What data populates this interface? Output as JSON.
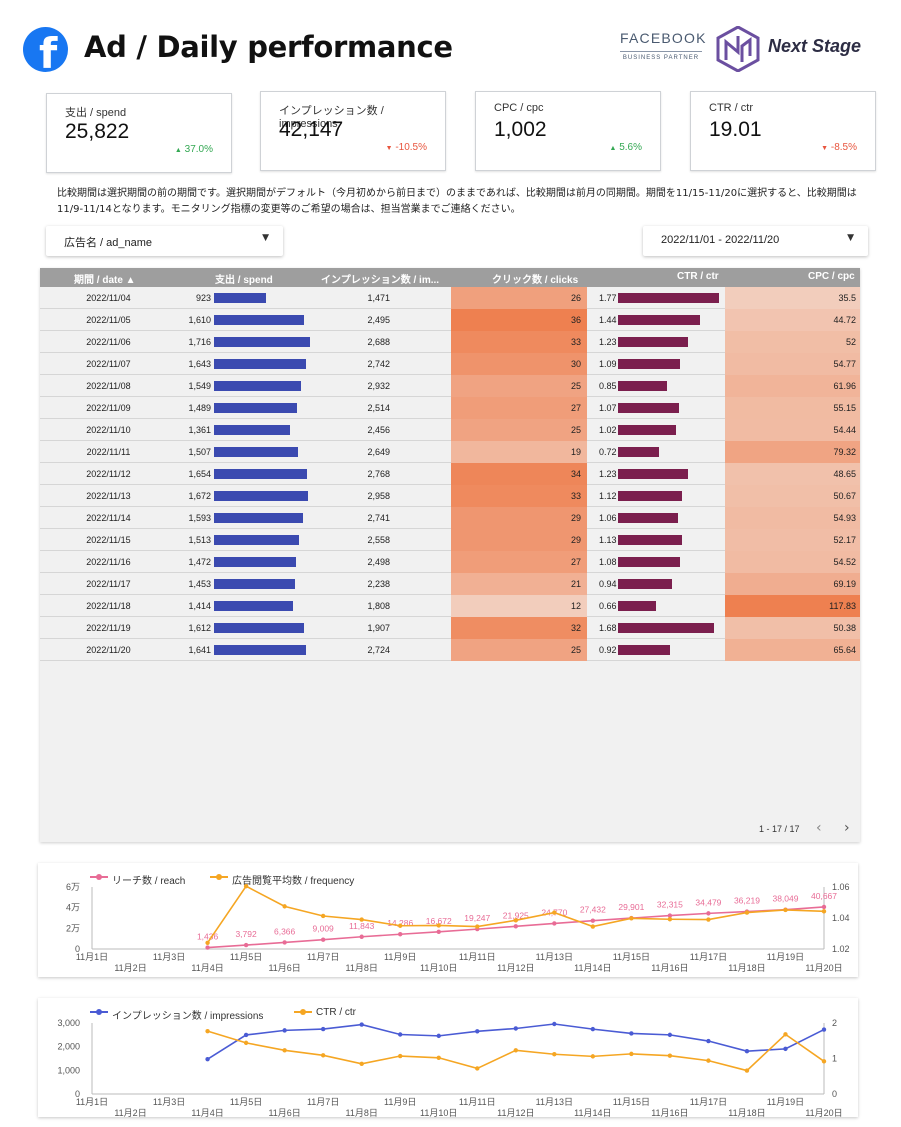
{
  "header": {
    "title": "Ad / Daily performance",
    "fb_logo_letter": "f",
    "facebook": "FACEBOOK",
    "business_partner": "BUSINESS PARTNER",
    "brand": "Next Stage"
  },
  "kpis": [
    {
      "label": "支出 / spend",
      "value": "25,822",
      "change": "37.0%",
      "direction": "up"
    },
    {
      "label": "インプレッション数 / impressions",
      "value": "42,147",
      "change": "-10.5%",
      "direction": "down"
    },
    {
      "label": "CPC / cpc",
      "value": "1,002",
      "change": "5.6%",
      "direction": "up"
    },
    {
      "label": "CTR / ctr",
      "value": "19.01",
      "change": "-8.5%",
      "direction": "down"
    }
  ],
  "note": "比較期間は選択期間の前の期間です。選択期間がデフォルト（今月初めから前日まで）のままであれば、比較期間は前月の同期間。期間を11/15-11/20に選択すると、比較期間は11/9-11/14となります。モニタリング指標の変更等のご希望の場合は、担当営業までご連絡ください。",
  "filters": {
    "ad_name": "広告名 / ad_name",
    "date_range": "2022/11/01 - 2022/11/20"
  },
  "table": {
    "headers": [
      "期間 / date ▲",
      "支出 / spend",
      "インプレッション数 / im...",
      "クリック数 / clicks",
      "CTR / ctr",
      "CPC / cpc"
    ],
    "rows": [
      {
        "date": "2022/11/04",
        "spend": "923",
        "impressions": "1,471",
        "clicks": "26",
        "ctr": "1.77",
        "cpc": "35.5"
      },
      {
        "date": "2022/11/05",
        "spend": "1,610",
        "impressions": "2,495",
        "clicks": "36",
        "ctr": "1.44",
        "cpc": "44.72"
      },
      {
        "date": "2022/11/06",
        "spend": "1,716",
        "impressions": "2,688",
        "clicks": "33",
        "ctr": "1.23",
        "cpc": "52"
      },
      {
        "date": "2022/11/07",
        "spend": "1,643",
        "impressions": "2,742",
        "clicks": "30",
        "ctr": "1.09",
        "cpc": "54.77"
      },
      {
        "date": "2022/11/08",
        "spend": "1,549",
        "impressions": "2,932",
        "clicks": "25",
        "ctr": "0.85",
        "cpc": "61.96"
      },
      {
        "date": "2022/11/09",
        "spend": "1,489",
        "impressions": "2,514",
        "clicks": "27",
        "ctr": "1.07",
        "cpc": "55.15"
      },
      {
        "date": "2022/11/10",
        "spend": "1,361",
        "impressions": "2,456",
        "clicks": "25",
        "ctr": "1.02",
        "cpc": "54.44"
      },
      {
        "date": "2022/11/11",
        "spend": "1,507",
        "impressions": "2,649",
        "clicks": "19",
        "ctr": "0.72",
        "cpc": "79.32"
      },
      {
        "date": "2022/11/12",
        "spend": "1,654",
        "impressions": "2,768",
        "clicks": "34",
        "ctr": "1.23",
        "cpc": "48.65"
      },
      {
        "date": "2022/11/13",
        "spend": "1,672",
        "impressions": "2,958",
        "clicks": "33",
        "ctr": "1.12",
        "cpc": "50.67"
      },
      {
        "date": "2022/11/14",
        "spend": "1,593",
        "impressions": "2,741",
        "clicks": "29",
        "ctr": "1.06",
        "cpc": "54.93"
      },
      {
        "date": "2022/11/15",
        "spend": "1,513",
        "impressions": "2,558",
        "clicks": "29",
        "ctr": "1.13",
        "cpc": "52.17"
      },
      {
        "date": "2022/11/16",
        "spend": "1,472",
        "impressions": "2,498",
        "clicks": "27",
        "ctr": "1.08",
        "cpc": "54.52"
      },
      {
        "date": "2022/11/17",
        "spend": "1,453",
        "impressions": "2,238",
        "clicks": "21",
        "ctr": "0.94",
        "cpc": "69.19"
      },
      {
        "date": "2022/11/18",
        "spend": "1,414",
        "impressions": "1,808",
        "clicks": "12",
        "ctr": "0.66",
        "cpc": "117.83"
      },
      {
        "date": "2022/11/19",
        "spend": "1,612",
        "impressions": "1,907",
        "clicks": "32",
        "ctr": "1.68",
        "cpc": "50.38"
      },
      {
        "date": "2022/11/20",
        "spend": "1,641",
        "impressions": "2,724",
        "clicks": "25",
        "ctr": "0.92",
        "cpc": "65.64"
      }
    ],
    "pagination": "1 - 17 / 17",
    "prev_icon": "‹",
    "next_icon": "›"
  },
  "chart_data": [
    {
      "type": "line",
      "legend": [
        "リーチ数 / reach",
        "広告閲覧平均数 / frequency"
      ],
      "colors": {
        "reach": "#e86c96",
        "frequency": "#f5a623"
      },
      "x_labels": [
        "11月1日",
        "11月2日",
        "11月3日",
        "11月4日",
        "11月5日",
        "11月6日",
        "11月7日",
        "11月8日",
        "11月9日",
        "11月10日",
        "11月11日",
        "11月12日",
        "11月13日",
        "11月14日",
        "11月15日",
        "11月16日",
        "11月17日",
        "11月18日",
        "11月19日",
        "11月20日"
      ],
      "y_left_ticks": [
        "6万",
        "4万",
        "2万",
        "0"
      ],
      "y_left_range": [
        0,
        60000
      ],
      "y_right_ticks": [
        "1.06",
        "1.04",
        "1.02"
      ],
      "y_right_range": [
        1.02,
        1.06
      ],
      "series": [
        {
          "name": "リーチ数 / reach",
          "axis": "left",
          "start_index": 3,
          "values": [
            1436,
            3792,
            6366,
            9009,
            11843,
            14286,
            16672,
            19247,
            21925,
            24770,
            27432,
            29901,
            32315,
            34479,
            36219,
            38049,
            40667
          ],
          "data_labels": [
            "1,436",
            "3,792",
            "6,366",
            "9,009",
            "11,843",
            "14,286",
            "16,672",
            "19,247",
            "21,925",
            "24,770",
            "27,432",
            "29,901",
            "32,315",
            "34,479",
            "36,219",
            "38,049",
            "40,667"
          ]
        },
        {
          "name": "広告閲覧平均数 / frequency",
          "axis": "right",
          "start_index": 3,
          "values": [
            1.024,
            1.0605,
            1.0475,
            1.0413,
            1.039,
            1.035,
            1.0352,
            1.0345,
            1.0385,
            1.0435,
            1.0345,
            1.0398,
            1.0392,
            1.039,
            1.0435,
            1.0452,
            1.0443
          ]
        }
      ]
    },
    {
      "type": "line",
      "legend": [
        "インプレッション数 / impressions",
        "CTR / ctr"
      ],
      "colors": {
        "impressions": "#4a5bd4",
        "ctr": "#f5a623"
      },
      "x_labels": [
        "11月1日",
        "11月2日",
        "11月3日",
        "11月4日",
        "11月5日",
        "11月6日",
        "11月7日",
        "11月8日",
        "11月9日",
        "11月10日",
        "11月11日",
        "11月12日",
        "11月13日",
        "11月14日",
        "11月15日",
        "11月16日",
        "11月17日",
        "11月18日",
        "11月19日",
        "11月20日"
      ],
      "y_left_ticks": [
        "3,000",
        "2,000",
        "1,000",
        "0"
      ],
      "y_left_range": [
        0,
        3000
      ],
      "y_right_ticks": [
        "2",
        "1",
        "0"
      ],
      "y_right_range": [
        0,
        2
      ],
      "series": [
        {
          "name": "インプレッション数 / impressions",
          "axis": "left",
          "start_index": 3,
          "values": [
            1471,
            2495,
            2688,
            2742,
            2932,
            2514,
            2456,
            2649,
            2768,
            2958,
            2741,
            2558,
            2498,
            2238,
            1808,
            1907,
            2724
          ]
        },
        {
          "name": "CTR / ctr",
          "axis": "right",
          "start_index": 3,
          "values": [
            1.77,
            1.44,
            1.23,
            1.09,
            0.85,
            1.07,
            1.02,
            0.72,
            1.23,
            1.12,
            1.06,
            1.13,
            1.08,
            0.94,
            0.66,
            1.68,
            0.92
          ]
        }
      ]
    }
  ]
}
